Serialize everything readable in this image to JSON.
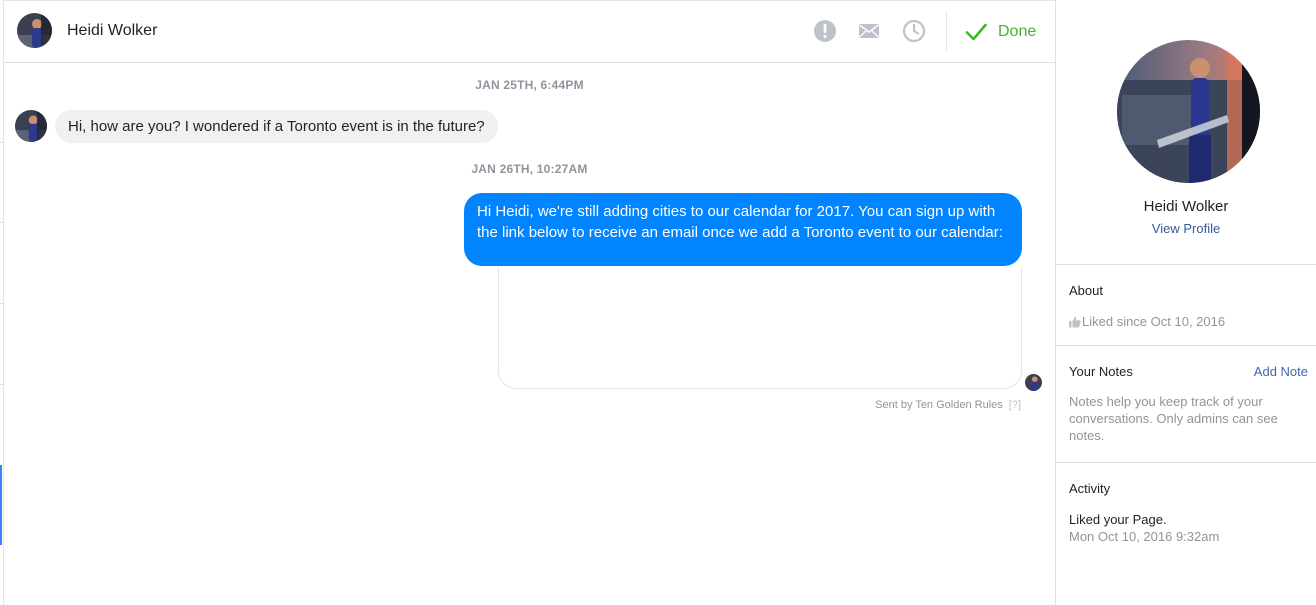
{
  "conversation": {
    "contact_name": "Heidi Wolker",
    "actions": {
      "spam_icon": "exclamation-circle-icon",
      "unread_icon": "envelope-icon",
      "followup_icon": "clock-icon",
      "done_label": "Done"
    },
    "messages": [
      {
        "timestamp": "JAN 25TH, 6:44PM",
        "direction": "incoming",
        "text": "Hi, how are you? I wondered if a Toronto event is in the future?"
      },
      {
        "timestamp": "JAN 26TH, 10:27AM",
        "direction": "outgoing",
        "text": "Hi Heidi, we're still adding cities to our calendar for 2017. You can sign up with the link below to receive an email once we add a Toronto event to our calendar:"
      }
    ],
    "sent_by": "Sent by Ten Golden Rules",
    "sent_by_help": "[?]"
  },
  "profile": {
    "name": "Heidi Wolker",
    "view_profile": "View Profile",
    "about_title": "About",
    "liked_since": "Liked since Oct 10, 2016",
    "notes_title": "Your Notes",
    "add_note": "Add Note",
    "notes_help": "Notes help you keep track of your conversations. Only admins can see notes.",
    "activity_title": "Activity",
    "activity_item": "Liked your Page.",
    "activity_time": "Mon Oct 10, 2016 9:32am"
  },
  "colors": {
    "accent_blue": "#0084ff",
    "done_green": "#42b72a",
    "link_blue": "#365899"
  }
}
